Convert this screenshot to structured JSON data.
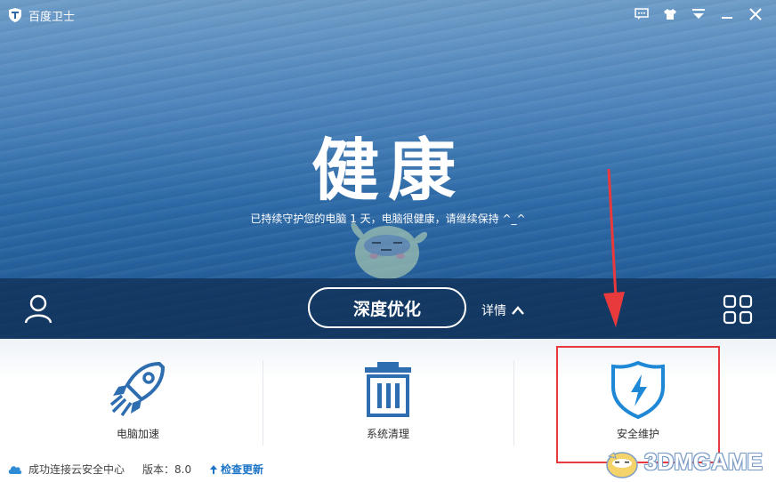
{
  "titlebar": {
    "app_title": "百度卫士",
    "icons": [
      "feedback-icon",
      "skin-icon",
      "menu-icon",
      "minimize-icon",
      "close-icon"
    ]
  },
  "hero": {
    "headline": "健康",
    "subline": "已持续守护您的电脑 1 天，电脑很健康，请继续保持 ^_^",
    "optimize_label": "深度优化",
    "details_label": "详情"
  },
  "features": [
    {
      "label": "电脑加速",
      "icon": "rocket-icon"
    },
    {
      "label": "系统清理",
      "icon": "trash-icon"
    },
    {
      "label": "安全维护",
      "icon": "shield-icon"
    }
  ],
  "status": {
    "cloud_text": "成功连接云安全中心",
    "version_text": "版本：8.0",
    "update_label": "检查更新"
  },
  "watermark": {
    "text": "3DMGAME"
  },
  "colors": {
    "accent": "#1a73c7",
    "highlight": "#e8393c",
    "hero": "#2d6aa7"
  }
}
